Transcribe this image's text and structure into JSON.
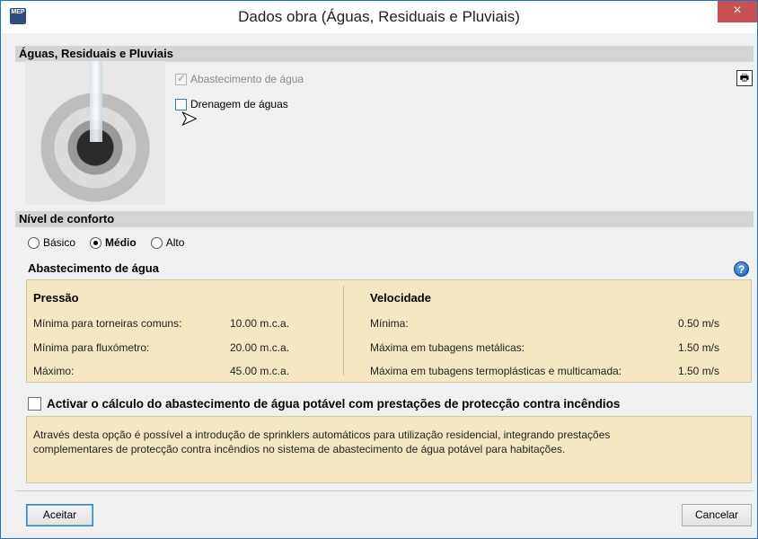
{
  "window": {
    "title": "Dados obra (Águas, Residuais e Pluviais)",
    "close": "×",
    "app_icon_text": "MEP"
  },
  "section_waters": {
    "title": "Águas, Residuais e Pluviais",
    "supply_label": "Abastecimento de água",
    "supply_checked": true,
    "supply_disabled": true,
    "drain_label": "Drenagem de águas",
    "drain_checked": false
  },
  "section_comfort": {
    "title": "Nível de conforto",
    "options": [
      "Básico",
      "Médio",
      "Alto"
    ],
    "selected": "Médio"
  },
  "supply": {
    "title": "Abastecimento de água",
    "pressure": {
      "heading": "Pressão",
      "rows": [
        {
          "label": "Mínima para torneiras comuns:",
          "value": "10.00 m.c.a."
        },
        {
          "label": "Mínima para fluxómetro:",
          "value": "20.00 m.c.a."
        },
        {
          "label": "Máximo:",
          "value": "45.00 m.c.a."
        }
      ]
    },
    "velocity": {
      "heading": "Velocidade",
      "rows": [
        {
          "label": "Mínima:",
          "value": "0.50 m/s"
        },
        {
          "label": "Máxima em tubagens metálicas:",
          "value": "1.50 m/s"
        },
        {
          "label": "Máxima em tubagens termoplásticas e multicamada:",
          "value": "1.50 m/s"
        }
      ]
    }
  },
  "fire": {
    "label": "Activar o cálculo do abastecimento de água potável com prestações de protecção contra incêndios",
    "checked": false,
    "description_line1": "Através desta opção é possível a introdução de sprinklers automáticos para utilização residencial, integrando prestações",
    "description_line2": "complementares de protecção contra incêndios no sistema de abastecimento de água potável para habitações."
  },
  "buttons": {
    "accept": "Aceitar",
    "cancel": "Cancelar"
  },
  "colors": {
    "accent": "#1b74c8",
    "panel": "#f4e8c3",
    "section_bar": "#d4d4d4",
    "close": "#c75050"
  }
}
